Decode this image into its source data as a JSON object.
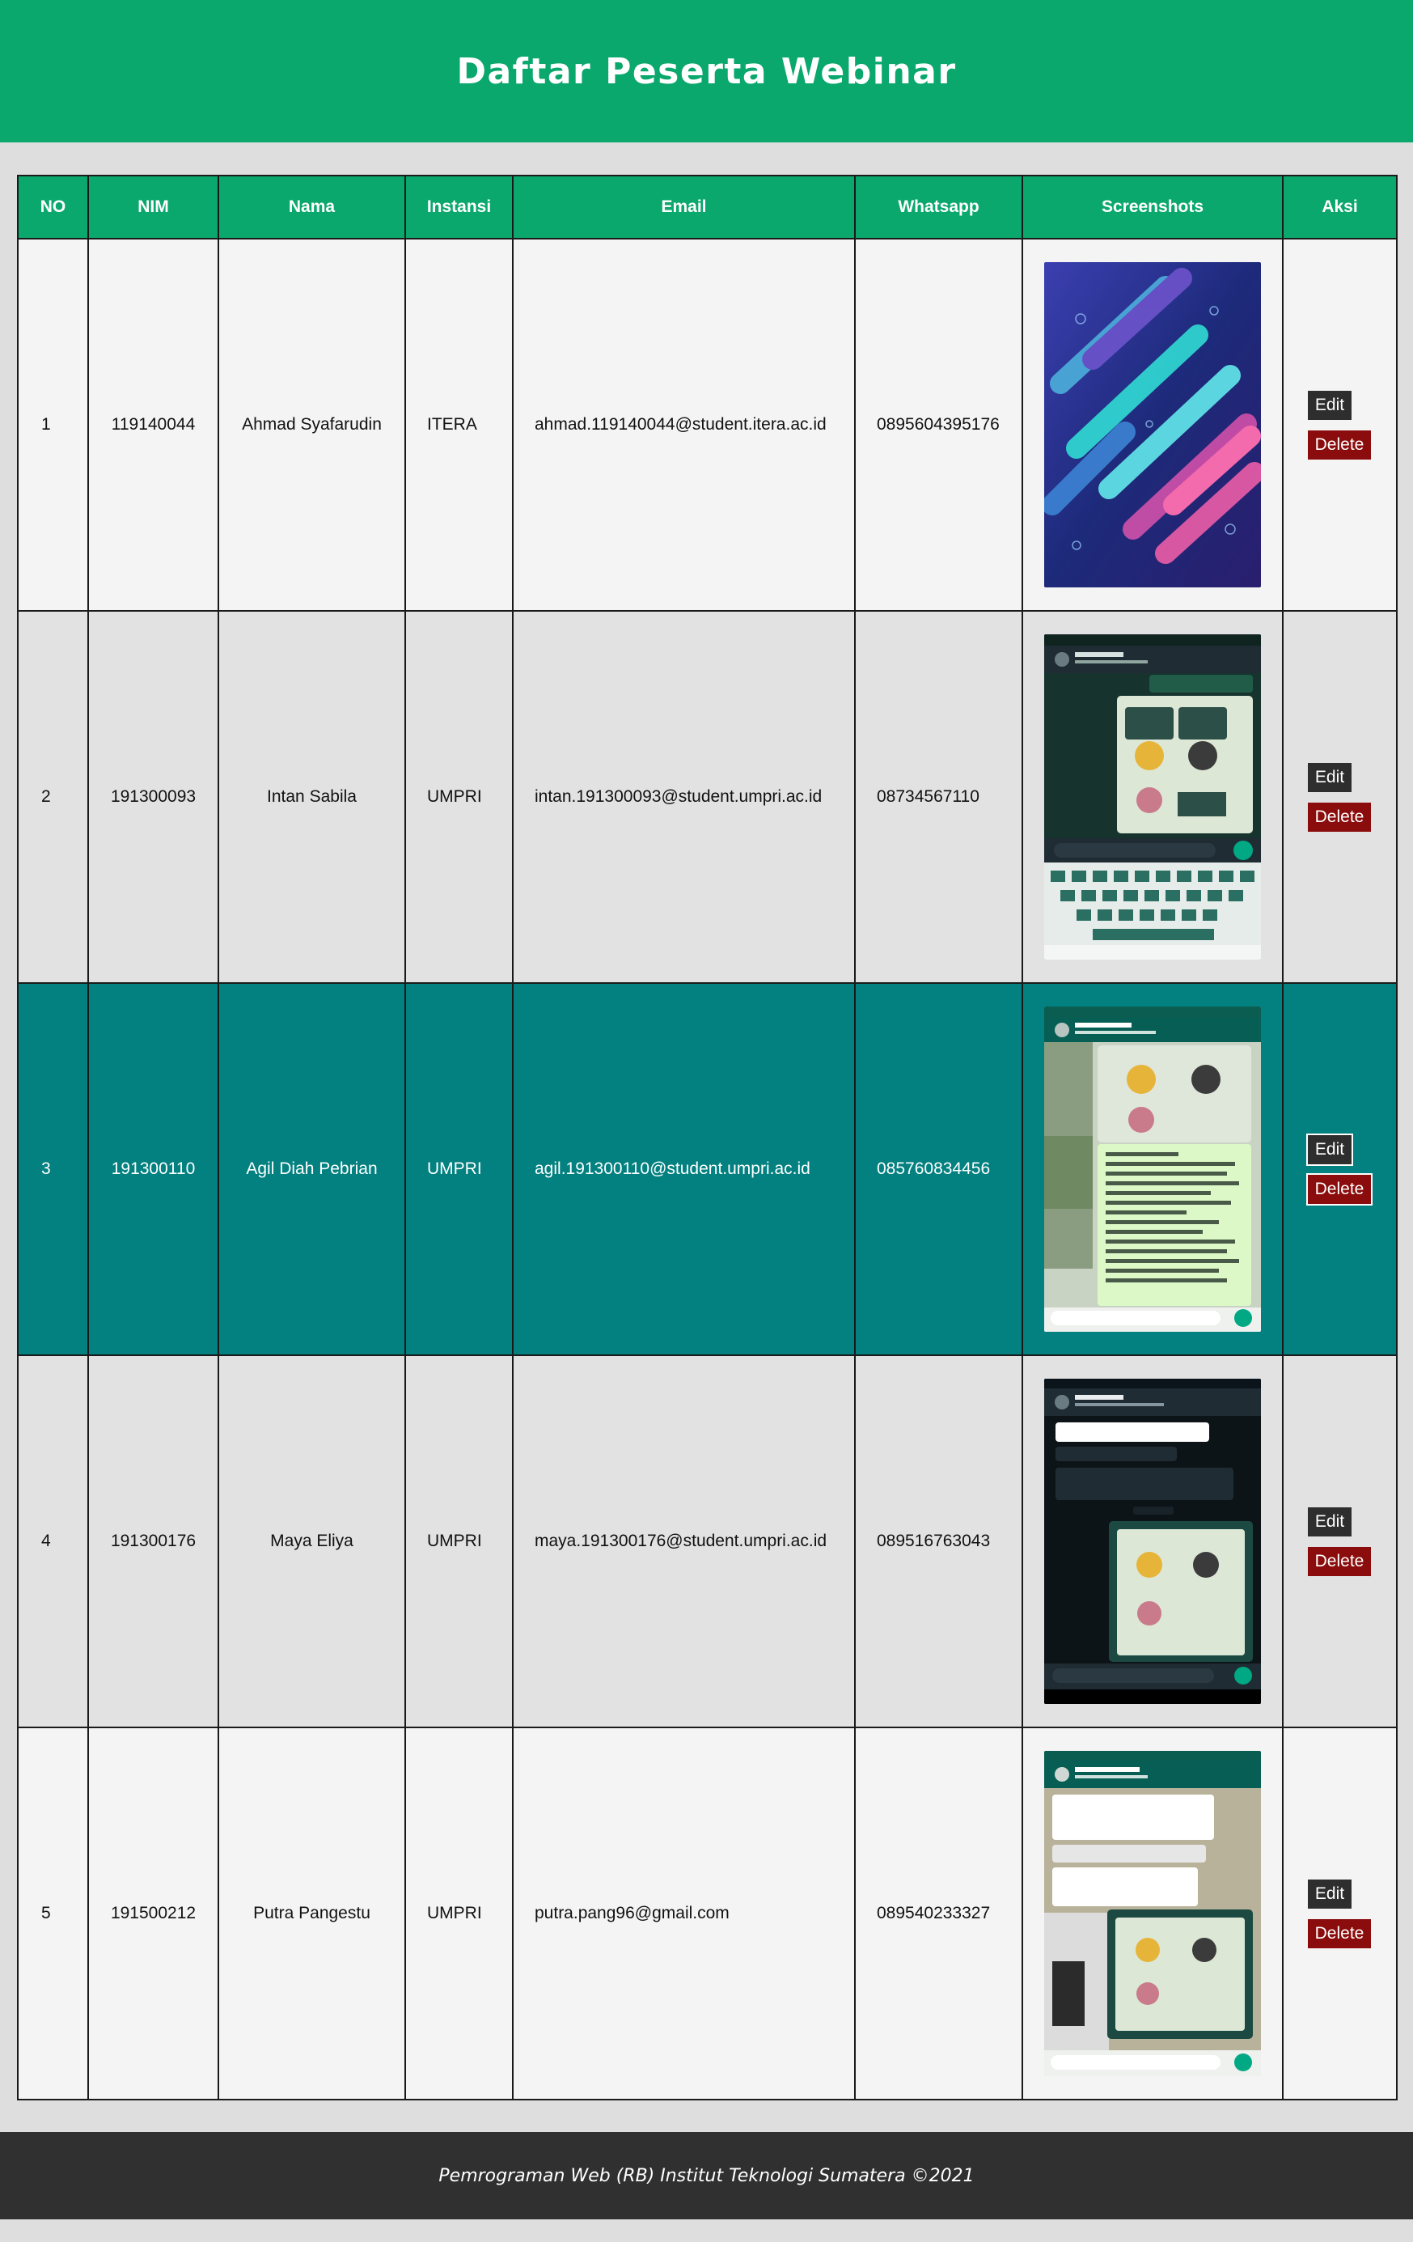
{
  "header": {
    "title": "Daftar Peserta Webinar"
  },
  "table": {
    "columns": [
      "NO",
      "NIM",
      "Nama",
      "Instansi",
      "Email",
      "Whatsapp",
      "Screenshots",
      "Aksi"
    ],
    "rows": [
      {
        "no": "1",
        "nim": "119140044",
        "nama": "Ahmad Syafarudin",
        "instansi": "ITERA",
        "email": "ahmad.119140044@student.itera.ac.id",
        "whatsapp": "0895604395176",
        "screenshot": "abstract-wallpaper-image",
        "edit": "Edit",
        "delete": "Delete"
      },
      {
        "no": "2",
        "nim": "191300093",
        "nama": "Intan Sabila",
        "instansi": "UMPRI",
        "email": "intan.191300093@student.umpri.ac.id",
        "whatsapp": "08734567110",
        "screenshot": "whatsapp-chat-screenshot",
        "edit": "Edit",
        "delete": "Delete"
      },
      {
        "no": "3",
        "nim": "191300110",
        "nama": "Agil Diah Pebrian",
        "instansi": "UMPRI",
        "email": "agil.191300110@student.umpri.ac.id",
        "whatsapp": "085760834456",
        "screenshot": "whatsapp-chat-screenshot",
        "edit": "Edit",
        "delete": "Delete"
      },
      {
        "no": "4",
        "nim": "191300176",
        "nama": "Maya Eliya",
        "instansi": "UMPRI",
        "email": "maya.191300176@student.umpri.ac.id",
        "whatsapp": "089516763043",
        "screenshot": "whatsapp-chat-screenshot",
        "edit": "Edit",
        "delete": "Delete"
      },
      {
        "no": "5",
        "nim": "191500212",
        "nama": "Putra Pangestu",
        "instansi": "UMPRI",
        "email": "putra.pang96@gmail.com",
        "whatsapp": "089540233327",
        "screenshot": "whatsapp-chat-screenshot",
        "edit": "Edit",
        "delete": "Delete"
      }
    ]
  },
  "footer": {
    "text": "Pemrograman Web (RB) Institut Teknologi Sumatera ©2021"
  },
  "colors": {
    "header_bg": "#0ba86e",
    "highlight_row": "#038080",
    "edit_button": "#2e2e2e",
    "delete_button": "#8b0c0c",
    "footer_bg": "#303030"
  }
}
